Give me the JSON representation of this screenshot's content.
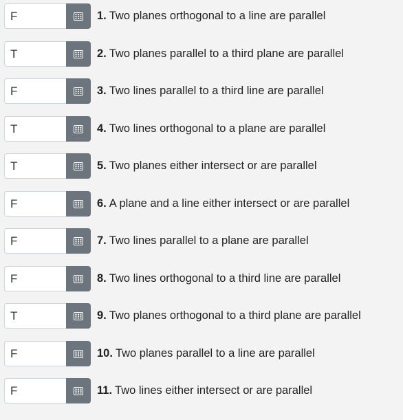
{
  "icon": "calculator-grid-icon",
  "colors": {
    "background": "#f3f3f3",
    "button": "#6c757d",
    "input_border": "#ced4da"
  },
  "items": [
    {
      "value": "F",
      "number": "1.",
      "text": "Two planes orthogonal to a line are parallel"
    },
    {
      "value": "T",
      "number": "2.",
      "text": "Two planes parallel to a third plane are parallel"
    },
    {
      "value": "F",
      "number": "3.",
      "text": "Two lines parallel to a third line are parallel"
    },
    {
      "value": "T",
      "number": "4.",
      "text": "Two lines orthogonal to a plane are parallel"
    },
    {
      "value": "T",
      "number": "5.",
      "text": "Two planes either intersect or are parallel"
    },
    {
      "value": "F",
      "number": "6.",
      "text": "A plane and a line either intersect or are parallel"
    },
    {
      "value": "F",
      "number": "7.",
      "text": "Two lines parallel to a plane are parallel"
    },
    {
      "value": "F",
      "number": "8.",
      "text": "Two lines orthogonal to a third line are parallel"
    },
    {
      "value": "T",
      "number": "9.",
      "text": "Two planes orthogonal to a third plane are parallel"
    },
    {
      "value": "F",
      "number": "10.",
      "text": "Two planes parallel to a line are parallel"
    },
    {
      "value": "F",
      "number": "11.",
      "text": "Two lines either intersect or are parallel"
    }
  ]
}
